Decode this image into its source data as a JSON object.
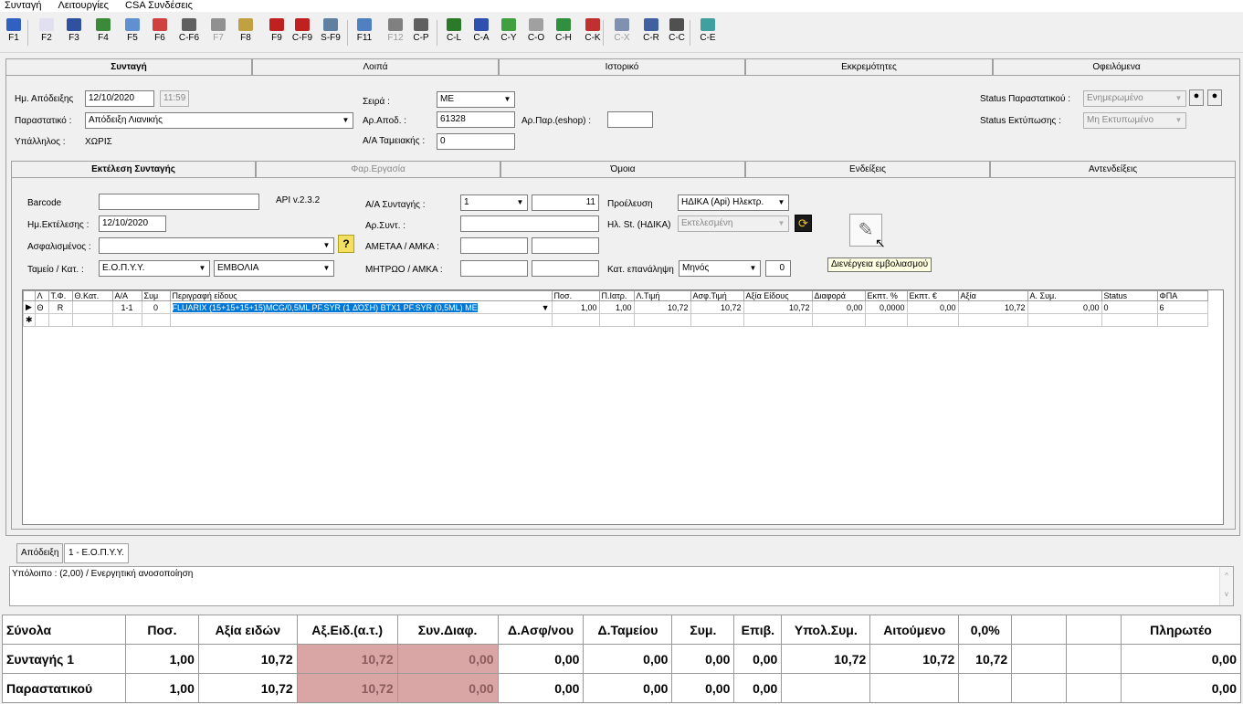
{
  "menu": [
    "Συνταγή",
    "Λειτουργίες",
    "CSA Συνδέσεις"
  ],
  "toolbar": [
    {
      "label": "F1",
      "icon": "help-icon",
      "color": "#3060c0"
    },
    {
      "label": "F2",
      "icon": "new-document-icon",
      "color": "#e0e0f0"
    },
    {
      "label": "F3",
      "icon": "save-icon",
      "color": "#3050a0"
    },
    {
      "label": "F4",
      "icon": "refresh-icon",
      "color": "#3a8a3a"
    },
    {
      "label": "F5",
      "icon": "reload-icon",
      "color": "#6090d0"
    },
    {
      "label": "F6",
      "icon": "chart-icon",
      "color": "#d04040"
    },
    {
      "label": "C-F6",
      "icon": "vat-icon",
      "color": "#606060"
    },
    {
      "label": "F7",
      "icon": "print-icon",
      "color": "#909090",
      "disabled": true
    },
    {
      "label": "F8",
      "icon": "folder-icon",
      "color": "#c0a040"
    },
    {
      "label": "F9",
      "icon": "delete-icon",
      "color": "#c02020"
    },
    {
      "label": "C-F9",
      "icon": "delete-doc-icon",
      "color": "#c02020"
    },
    {
      "label": "S-F9",
      "icon": "grid-icon",
      "color": "#6080a0"
    },
    {
      "label": "F11",
      "icon": "search-icon",
      "color": "#5080c0"
    },
    {
      "label": "F12",
      "icon": "printer-icon",
      "color": "#808080",
      "disabled": true
    },
    {
      "label": "C-P",
      "icon": "print-preview-icon",
      "color": "#606060"
    },
    {
      "label": "C-L",
      "icon": "pharmacy-icon",
      "color": "#2a7a2a"
    },
    {
      "label": "C-A",
      "icon": "book-icon",
      "color": "#3050b0"
    },
    {
      "label": "C-Y",
      "icon": "bar-chart-icon",
      "color": "#40a040"
    },
    {
      "label": "C-O",
      "icon": "tag-icon",
      "color": "#a0a0a0"
    },
    {
      "label": "C-H",
      "icon": "shield-icon",
      "color": "#309040"
    },
    {
      "label": "C-K",
      "icon": "target-icon",
      "color": "#c03030"
    },
    {
      "label": "C-X",
      "icon": "table-icon",
      "color": "#8090b0",
      "disabled": true
    },
    {
      "label": "C-R",
      "icon": "edit-doc-icon",
      "color": "#4060a0"
    },
    {
      "label": "C-C",
      "icon": "list-icon",
      "color": "#505050"
    },
    {
      "label": "C-E",
      "icon": "exit-icon",
      "color": "#40a0a0"
    }
  ],
  "main_tabs": [
    "Συνταγή",
    "Λοιπά",
    "Ιστορικό",
    "Εκκρεμότητες",
    "Οφειλόμενα"
  ],
  "header": {
    "date_label": "Ημ. Απόδειξης",
    "date": "12/10/2020",
    "time": "11:59",
    "doc_label": "Παραστατικό :",
    "doc": "Απόδειξη Λιανικής",
    "employee_label": "Υπάλληλος :",
    "employee": "ΧΩΡΙΣ",
    "series_label": "Σειρά :",
    "series": "ΜΕ",
    "receipt_no_label": "Αρ.Αποδ. :",
    "receipt_no": "61328",
    "eshop_label": "Αρ.Παρ.(eshop) :",
    "eshop": "",
    "cashier_label": "Α/Α Ταμειακής :",
    "cashier": "0",
    "status_doc_label": "Status Παραστατικού :",
    "status_doc": "Ενημερωμένο",
    "status_print_label": "Status Εκτύπωσης :",
    "status_print": "Μη Εκτυπωμένο"
  },
  "sub_tabs": [
    "Εκτέλεση Συνταγής",
    "Φαρ.Εργασία",
    "Όμοια",
    "Ενδείξεις",
    "Αντενδείξεις"
  ],
  "rx": {
    "barcode_label": "Barcode",
    "barcode": "",
    "api": "API v.2.3.2",
    "exec_date_label": "Ημ.Εκτέλεσης :",
    "exec_date": "12/10/2020",
    "insured_label": "Ασφαλισμένος :",
    "insured": "",
    "fund_label": "Ταμείο / Κατ. :",
    "fund": "Ε.Ο.Π.Υ.Υ.",
    "category": "ΕΜΒΟΛΙΑ",
    "aa_label": "Α/Α Συνταγής :",
    "aa": "1",
    "aa_count": "11",
    "rx_no_label": "Αρ.Συντ. :",
    "ametaa_label": "ΑΜΕΤΑΑ / ΑΜΚΑ :",
    "mitroo_label": "ΜΗΤΡΩΟ / ΑΜΚΑ :",
    "origin_label": "Προέλευση",
    "origin": "ΗΔΙΚΑ (Api) Ηλεκτρ.",
    "hl_status_label": "Ηλ. St. (ΗΔΙΚΑ)",
    "hl_status": "Εκτελεσμένη",
    "repeat_label": "Κατ. επανάληψη",
    "repeat": "Μηνός",
    "repeat_n": "0",
    "tooltip": "Διενέργεια εμβολιασμού"
  },
  "grid": {
    "columns": [
      "Λ",
      "Τ.Φ.",
      "Θ.Κατ.",
      "Α/Α",
      "Συμ",
      "Περιγραφή είδους",
      "Ποσ.",
      "Π.Ιατρ.",
      "Λ.Τιμή",
      "Ασφ.Τιμή",
      "Αξία Είδους",
      "Διαφορά",
      "Εκπτ. %",
      "Εκπτ. €",
      "Αξία",
      "Α. Συμ.",
      "Status",
      "ΦΠΑ"
    ],
    "rows": [
      [
        "Θ",
        "R",
        "",
        "1-1",
        "0",
        "FLUARIX (15+15+15+15)MCG/0,5ML PF.SYR (1 ΔΌΣΗ) BTX1 PF.SYR (0,5ML) ME",
        "1,00",
        "1,00",
        "10,72",
        "10,72",
        "10,72",
        "0,00",
        "0,0000",
        "0,00",
        "10,72",
        "0,00",
        "0",
        "6"
      ]
    ]
  },
  "bottom_tabs": [
    "Απόδειξη",
    "1 - Ε.Ο.Π.Υ.Υ."
  ],
  "note": "Υπόλοιπο : (2,00)  / Ενεργητική ανοσοποίηση",
  "totals": {
    "header": [
      "Σύνολα",
      "Ποσ.",
      "Αξία ειδών",
      "Αξ.Ειδ.(α.τ.)",
      "Συν.Διαφ.",
      "Δ.Ασφ/νου",
      "Δ.Ταμείου",
      "Συμ.",
      "Επιβ.",
      "Υπολ.Συμ.",
      "Αιτούμενο",
      "0,0%",
      "",
      "",
      "Πληρωτέο"
    ],
    "rows": [
      [
        "Συνταγής 1",
        "1,00",
        "10,72",
        "10,72",
        "0,00",
        "0,00",
        "0,00",
        "0,00",
        "0,00",
        "10,72",
        "10,72",
        "10,72",
        "",
        "",
        "0,00"
      ],
      [
        "Παραστατικού",
        "1,00",
        "10,72",
        "10,72",
        "0,00",
        "0,00",
        "0,00",
        "0,00",
        "0,00",
        "",
        "",
        "",
        "",
        "",
        "0,00"
      ]
    ]
  }
}
